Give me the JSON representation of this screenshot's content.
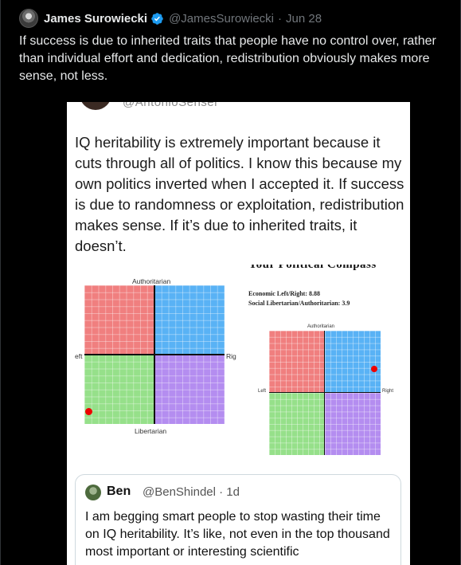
{
  "tweet": {
    "author_name": "James Surowiecki",
    "handle": "@JamesSurowiecki",
    "separator": "·",
    "date": "Jun 28",
    "text": "If success is due to inherited traits that people have no control over, rather than individual effort and dedication, redistribution obviously makes more sense, not less."
  },
  "media": {
    "cut_handle": "@AntonioSenser",
    "quoted_text": "IQ heritability is extremely important because it cuts through all of politics. I know this because my own politics inverted when I accepted it. If success is due to randomness or exploitation, redistribution makes sense. If it’s due to inherited traits, it doesn’t.",
    "compass_left": {
      "top_label": "Authoritarian",
      "bottom_label": "Libertarian",
      "left_label": "eft",
      "right_label": "Rig",
      "economic": -9.4,
      "social": -8.2
    },
    "compass_right": {
      "title": "Your Political Compass",
      "economic_label": "Economic Left/Right: 8.88",
      "social_label": "Social Libertarian/Authoritarian: 3.9",
      "top_label": "Authoritarian",
      "left_label": "Left",
      "right_label": "Right",
      "economic": 8.88,
      "social": 3.9
    },
    "quadrant_colors": {
      "auth_left": "#f07f7f",
      "auth_right": "#59b2f5",
      "lib_left": "#96e08a",
      "lib_right": "#b48df0"
    },
    "inner_quote": {
      "name": "Ben",
      "handle": "@BenShindel · 1d",
      "text": "I am begging smart people to stop wasting their time on IQ heritability.  It’s like, not even in the top thousand most important or interesting scientific"
    }
  }
}
